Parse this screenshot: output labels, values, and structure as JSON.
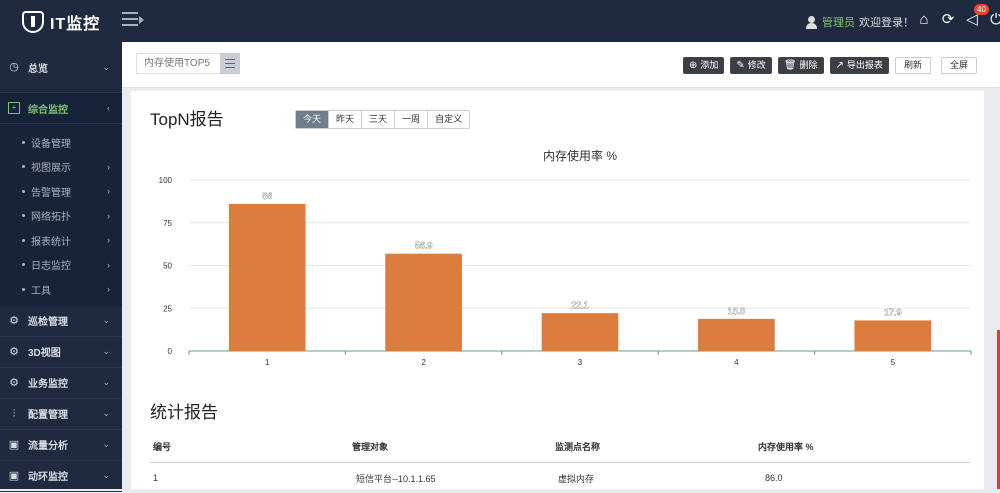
{
  "app": {
    "logo_text": "IT监控",
    "user_name": "管理员",
    "welcome": "欢迎登录！",
    "badge_count": "40"
  },
  "top_icons": [
    "home-icon",
    "refresh-icon",
    "notification-icon",
    "power-icon"
  ],
  "sidebar": {
    "items": [
      {
        "label": "总览",
        "icon": "dashboard-icon"
      },
      {
        "label": "综合监控",
        "icon": "monitor-icon",
        "active": true
      },
      {
        "label": "巡检管理",
        "icon": "inspect-icon"
      },
      {
        "label": "3D视图",
        "icon": "3d-icon"
      },
      {
        "label": "业务监控",
        "icon": "business-icon"
      },
      {
        "label": "配置管理",
        "icon": "config-icon"
      },
      {
        "label": "流量分析",
        "icon": "traffic-icon"
      },
      {
        "label": "动环监控",
        "icon": "environment-icon"
      }
    ],
    "submenu": [
      {
        "label": "设备管理"
      },
      {
        "label": "视图展示"
      },
      {
        "label": "告警管理"
      },
      {
        "label": "网络拓扑"
      },
      {
        "label": "报表统计"
      },
      {
        "label": "日志监控"
      },
      {
        "label": "工具"
      }
    ]
  },
  "toolbar": {
    "tab_label": "内存使用TOP5",
    "buttons": {
      "add": "添加",
      "edit": "修改",
      "delete": "删除",
      "export": "导出报表",
      "refresh": "刷新",
      "fullscreen": "全屏"
    }
  },
  "report": {
    "title": "TopN报告",
    "ranges": [
      "今天",
      "昨天",
      "三天",
      "一周",
      "自定义"
    ],
    "active_range": "今天"
  },
  "chart_data": {
    "type": "bar",
    "title": "内存使用率 %",
    "categories": [
      "1",
      "2",
      "3",
      "4",
      "5"
    ],
    "values": [
      86,
      56.9,
      22.1,
      18.8,
      17.9
    ],
    "ylim": [
      0,
      100
    ],
    "yticks": [
      0,
      25,
      50,
      75,
      100
    ],
    "grid": true,
    "bar_color": "#dc7c3e"
  },
  "stats": {
    "title": "统计报告",
    "headers": [
      "编号",
      "管理对象",
      "监测点名称",
      "内存使用率 %"
    ],
    "rows": [
      [
        "1",
        "短信平台--10.1.1.65",
        "虚拟内存",
        "86.0"
      ]
    ]
  }
}
